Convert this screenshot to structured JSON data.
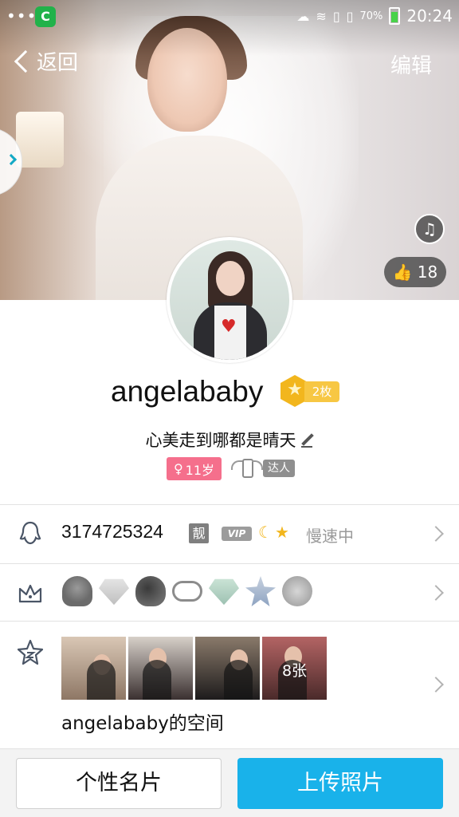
{
  "status_bar": {
    "battery_percent": "70%",
    "time": "20:24"
  },
  "header": {
    "back_label": "返回",
    "edit_label": "编辑"
  },
  "cover": {
    "like_count": "18"
  },
  "profile": {
    "username": "angelababy",
    "medal_count": "2枚",
    "signature": "心美走到哪都是晴天",
    "age_badge": "11岁",
    "talent_tag": "达人"
  },
  "account_row": {
    "qq_number": "3174725324",
    "liang_badge": "靓",
    "vip_badge": "VIP",
    "speed_status": "慢速中"
  },
  "services_row": {
    "icons": [
      "penguin-badge-icon",
      "diamond-icon",
      "black-penguin-icon",
      "cloud-icon",
      "green-diamond-icon",
      "star-icon",
      "lightning-icon"
    ]
  },
  "space_row": {
    "photo_count": "8张",
    "title": "angelababy的空间"
  },
  "bottom": {
    "card_button": "个性名片",
    "upload_button": "上传照片"
  },
  "colors": {
    "primary_blue": "#19b2ea",
    "age_pink": "#f56f8c",
    "medal_gold": "#f2b61d"
  }
}
